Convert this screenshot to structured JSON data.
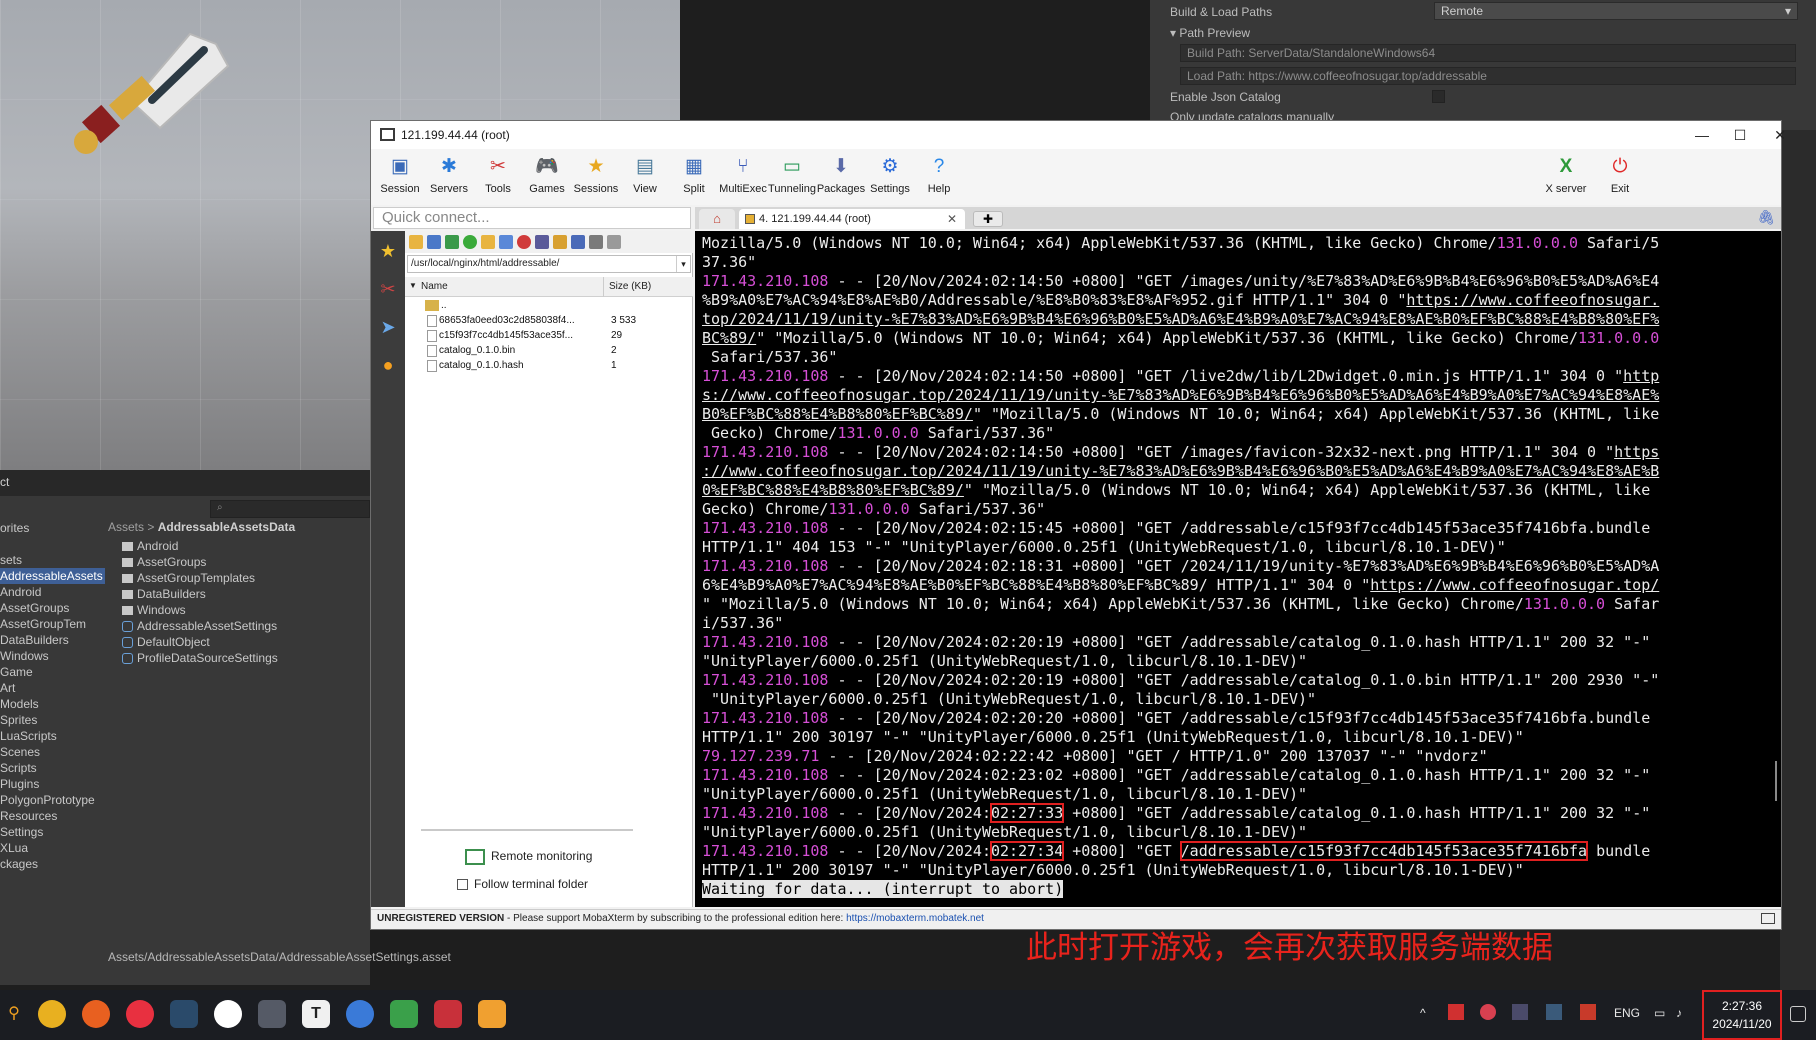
{
  "unity": {
    "inspector": {
      "build_load_paths_label": "Build & Load Paths",
      "build_load_paths_value": "Remote",
      "path_preview_label": "Path Preview",
      "build_path": "Build Path: ServerData/StandaloneWindows64",
      "load_path": "Load Path: https://www.coffeeofnosugar.top/addressable",
      "enable_json_catalog": "Enable Json Catalog",
      "only_update_catalogs": "Only update catalogs manually"
    },
    "project": {
      "header_label": "ct",
      "breadcrumb_root": "Assets",
      "breadcrumb_sep": ">",
      "breadcrumb_current": "AddressableAssetsData",
      "tree": [
        "orites",
        "",
        "sets",
        "AddressableAssets",
        "Android",
        "AssetGroups",
        "AssetGroupTem",
        "DataBuilders",
        "Windows",
        "Game",
        "Art",
        "Models",
        "Sprites",
        "LuaScripts",
        "Scenes",
        "Scripts",
        "Plugins",
        "PolygonPrototype",
        "Resources",
        "Settings",
        "XLua",
        "ckages"
      ],
      "assets": [
        {
          "name": "Android",
          "kind": "folder"
        },
        {
          "name": "AssetGroups",
          "kind": "folder"
        },
        {
          "name": "AssetGroupTemplates",
          "kind": "folder"
        },
        {
          "name": "DataBuilders",
          "kind": "folder"
        },
        {
          "name": "Windows",
          "kind": "folder"
        },
        {
          "name": "AddressableAssetSettings",
          "kind": "asset"
        },
        {
          "name": "DefaultObject",
          "kind": "asset"
        },
        {
          "name": "ProfileDataSourceSettings",
          "kind": "asset"
        }
      ],
      "asset_path": "Assets/AddressableAssetsData/AddressableAssetSettings.asset"
    }
  },
  "moba": {
    "title": "121.199.44.44 (root)",
    "toolbar": [
      "Session",
      "Servers",
      "Tools",
      "Games",
      "Sessions",
      "View",
      "Split",
      "MultiExec",
      "Tunneling",
      "Packages",
      "Settings",
      "Help"
    ],
    "toolbar_right": [
      "X server",
      "Exit"
    ],
    "quick_connect_placeholder": "Quick connect...",
    "tab_label": "4. 121.199.44.44 (root)",
    "sftp": {
      "path": "/usr/local/nginx/html/addressable/",
      "col_name": "Name",
      "col_size": "Size (KB)",
      "parent": "..",
      "files": [
        {
          "name": "68653fa0eed03c2d858038f4...",
          "size": "3 533"
        },
        {
          "name": "c15f93f7cc4db145f53ace35f...",
          "size": "29"
        },
        {
          "name": "catalog_0.1.0.bin",
          "size": "2"
        },
        {
          "name": "catalog_0.1.0.hash",
          "size": "1"
        }
      ],
      "remote_monitoring": "Remote monitoring",
      "follow_terminal_folder": "Follow terminal folder"
    },
    "status": {
      "unregistered": "UNREGISTERED VERSION",
      "message": " -  Please support MobaXterm by subscribing to the professional edition here: ",
      "link": "https://mobaxterm.mobatek.net"
    }
  },
  "terminal": [
    [
      {
        "t": "Mozilla/5.0 (Windows NT 10.0; Win64; x64) AppleWebKit/537.36 (KHTML, like Gecko) Chrome/"
      },
      {
        "t": "131.0.0.0",
        "c": "vn"
      },
      {
        "t": " Safari/5"
      }
    ],
    [
      {
        "t": "37.36\""
      }
    ],
    [
      {
        "t": "171.43.210.108",
        "c": "ip"
      },
      {
        "t": " - - [20/Nov/2024:02:14:50 +0800] \"GET /images/unity/%E7%83%AD%E6%9B%B4%E6%96%B0%E5%AD%A6%E4"
      }
    ],
    [
      {
        "t": "%B9%A0%E7%AC%94%E8%AE%B0/Addressable/%E8%B0%83%E8%AF%952.gif HTTP/1.1\" 304 0 \""
      },
      {
        "t": "https://www.coffeeofnosugar.",
        "c": "ul"
      }
    ],
    [
      {
        "t": "top/2024/11/19/unity-%E7%83%AD%E6%9B%B4%E6%96%B0%E5%AD%A6%E4%B9%A0%E7%AC%94%E8%AE%B0%EF%BC%88%E4%B8%80%EF%",
        "c": "ul"
      }
    ],
    [
      {
        "t": "BC%89/",
        "c": "ul"
      },
      {
        "t": "\" \"Mozilla/5.0 (Windows NT 10.0; Win64; x64) AppleWebKit/537.36 (KHTML, like Gecko) Chrome/"
      },
      {
        "t": "131.0.0.0",
        "c": "vn"
      }
    ],
    [
      {
        "t": " Safari/537.36\""
      }
    ],
    [
      {
        "t": "171.43.210.108",
        "c": "ip"
      },
      {
        "t": " - - [20/Nov/2024:02:14:50 +0800] \"GET /live2dw/lib/L2Dwidget.0.min.js HTTP/1.1\" 304 0 \""
      },
      {
        "t": "http",
        "c": "ul"
      }
    ],
    [
      {
        "t": "s://www.coffeeofnosugar.top/2024/11/19/unity-%E7%83%AD%E6%9B%B4%E6%96%B0%E5%AD%A6%E4%B9%A0%E7%AC%94%E8%AE%",
        "c": "ul"
      }
    ],
    [
      {
        "t": "B0%EF%BC%88%E4%B8%80%EF%BC%89/",
        "c": "ul"
      },
      {
        "t": "\" \"Mozilla/5.0 (Windows NT 10.0; Win64; x64) AppleWebKit/537.36 (KHTML, like"
      }
    ],
    [
      {
        "t": " Gecko) Chrome/"
      },
      {
        "t": "131.0.0.0",
        "c": "vn"
      },
      {
        "t": " Safari/537.36\""
      }
    ],
    [
      {
        "t": "171.43.210.108",
        "c": "ip"
      },
      {
        "t": " - - [20/Nov/2024:02:14:50 +0800] \"GET /images/favicon-32x32-next.png HTTP/1.1\" 304 0 \""
      },
      {
        "t": "https",
        "c": "ul"
      }
    ],
    [
      {
        "t": "://www.coffeeofnosugar.top/2024/11/19/unity-%E7%83%AD%E6%9B%B4%E6%96%B0%E5%AD%A6%E4%B9%A0%E7%AC%94%E8%AE%B",
        "c": "ul"
      }
    ],
    [
      {
        "t": "0%EF%BC%88%E4%B8%80%EF%BC%89/",
        "c": "ul"
      },
      {
        "t": "\" \"Mozilla/5.0 (Windows NT 10.0; Win64; x64) AppleWebKit/537.36 (KHTML, like"
      }
    ],
    [
      {
        "t": "Gecko) Chrome/"
      },
      {
        "t": "131.0.0.0",
        "c": "vn"
      },
      {
        "t": " Safari/537.36\""
      }
    ],
    [
      {
        "t": "171.43.210.108",
        "c": "ip"
      },
      {
        "t": " - - [20/Nov/2024:02:15:45 +0800] \"GET /addressable/c15f93f7cc4db145f53ace35f7416bfa.bundle"
      }
    ],
    [
      {
        "t": "HTTP/1.1\" 404 153 \"-\" \"UnityPlayer/6000.0.25f1 (UnityWebRequest/1.0, libcurl/8.10.1-DEV)\""
      }
    ],
    [
      {
        "t": "171.43.210.108",
        "c": "ip"
      },
      {
        "t": " - - [20/Nov/2024:02:18:31 +0800] \"GET /2024/11/19/unity-%E7%83%AD%E6%9B%B4%E6%96%B0%E5%AD%A"
      }
    ],
    [
      {
        "t": "6%E4%B9%A0%E7%AC%94%E8%AE%B0%EF%BC%88%E4%B8%80%EF%BC%89/ HTTP/1.1\" 304 0 \""
      },
      {
        "t": "https://www.coffeeofnosugar.top/",
        "c": "ul"
      }
    ],
    [
      {
        "t": "\" \"Mozilla/5.0 (Windows NT 10.0; Win64; x64) AppleWebKit/537.36 (KHTML, like Gecko) Chrome/"
      },
      {
        "t": "131.0.0.0",
        "c": "vn"
      },
      {
        "t": " Safar"
      }
    ],
    [
      {
        "t": "i/537.36\""
      }
    ],
    [
      {
        "t": "171.43.210.108",
        "c": "ip"
      },
      {
        "t": " - - [20/Nov/2024:02:20:19 +0800] \"GET /addressable/catalog_0.1.0.hash HTTP/1.1\" 200 32 \"-\""
      }
    ],
    [
      {
        "t": "\"UnityPlayer/6000.0.25f1 (UnityWebRequest/1.0, libcurl/8.10.1-DEV)\""
      }
    ],
    [
      {
        "t": "171.43.210.108",
        "c": "ip"
      },
      {
        "t": " - - [20/Nov/2024:02:20:19 +0800] \"GET /addressable/catalog_0.1.0.bin HTTP/1.1\" 200 2930 \"-\""
      }
    ],
    [
      {
        "t": " \"UnityPlayer/6000.0.25f1 (UnityWebRequest/1.0, libcurl/8.10.1-DEV)\""
      }
    ],
    [
      {
        "t": "171.43.210.108",
        "c": "ip"
      },
      {
        "t": " - - [20/Nov/2024:02:20:20 +0800] \"GET /addressable/c15f93f7cc4db145f53ace35f7416bfa.bundle"
      }
    ],
    [
      {
        "t": "HTTP/1.1\" 200 30197 \"-\" \"UnityPlayer/6000.0.25f1 (UnityWebRequest/1.0, libcurl/8.10.1-DEV)\""
      }
    ],
    [
      {
        "t": "79.127.239.71",
        "c": "ip"
      },
      {
        "t": " - - [20/Nov/2024:02:22:42 +0800] \"GET / HTTP/1.0\" 200 137037 \"-\" \"nvdorz\""
      }
    ],
    [
      {
        "t": "171.43.210.108",
        "c": "ip"
      },
      {
        "t": " - - [20/Nov/2024:02:23:02 +0800] \"GET /addressable/catalog_0.1.0.hash HTTP/1.1\" 200 32 \"-\""
      }
    ],
    [
      {
        "t": "\"UnityPlayer/6000.0.25f1 (UnityWebRequest/1.0, libcurl/8.10.1-DEV)\""
      }
    ],
    [
      {
        "t": "171.43.210.108",
        "c": "ip"
      },
      {
        "t": " - - [20/Nov/2024:"
      },
      {
        "t": "02:27:33",
        "c": "hl"
      },
      {
        "t": " +0800] \"GET /addressable/catalog_0.1.0.hash HTTP/1.1\" 200 32 \"-\""
      }
    ],
    [
      {
        "t": "\"UnityPlayer/6000.0.25f1 (UnityWebRequest/1.0, libcurl/8.10.1-DEV)\""
      }
    ],
    [
      {
        "t": "171.43.210.108",
        "c": "ip"
      },
      {
        "t": " - - [20/Nov/2024:"
      },
      {
        "t": "02:27:34",
        "c": "hl"
      },
      {
        "t": " +0800] \"GET "
      },
      {
        "t": "/addressable/c15f93f7cc4db145f53ace35f7416bfa",
        "c": "hl"
      },
      {
        "t": " bundle"
      }
    ],
    [
      {
        "t": "HTTP/1.1\" 200 30197 \"-\" \"UnityPlayer/6000.0.25f1 (UnityWebRequest/1.0, libcurl/8.10.1-DEV)\""
      }
    ],
    [
      {
        "t": "Waiting for data... (interrupt to abort)",
        "c": "waitbox"
      }
    ]
  ],
  "annotation": "此时打开游戏，会再次获取服务端数据",
  "taskbar": {
    "tray_lang": "ENG",
    "time": "2:27:36",
    "date": "2024/11/20"
  },
  "colors": {
    "ip_magenta": "#d64fd6",
    "highlight_red": "#e02020"
  }
}
